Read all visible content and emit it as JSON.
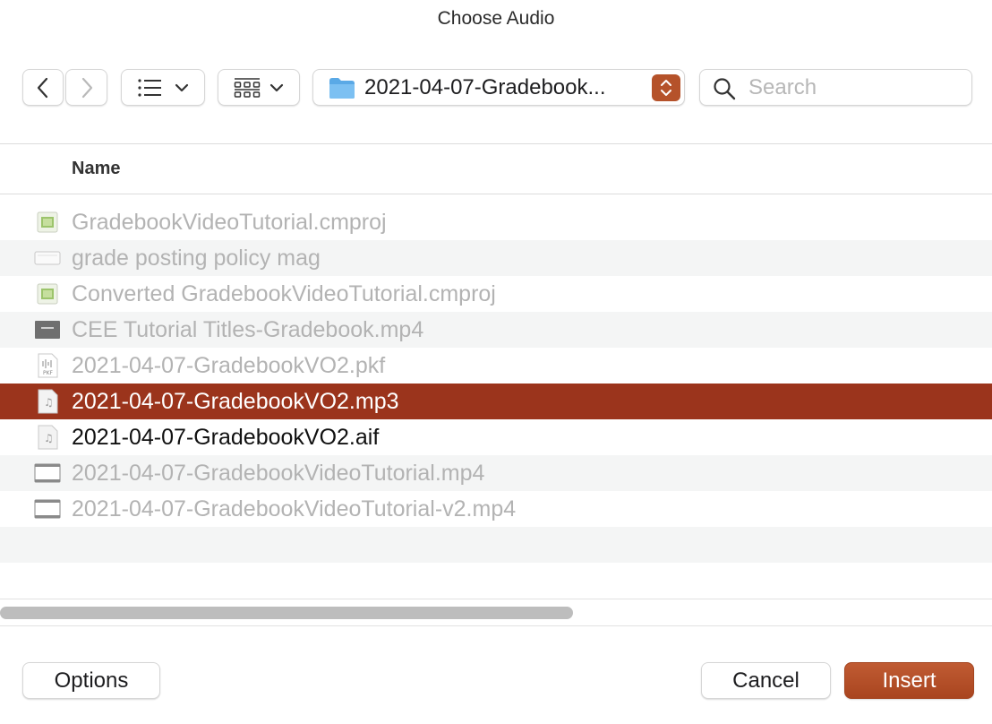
{
  "dialog": {
    "title": "Choose Audio"
  },
  "toolbar": {
    "back": "back",
    "forward": "forward",
    "list_view": "list-view",
    "icon_view": "icon-view",
    "location": "2021-04-07-Gradebook...",
    "search_placeholder": "Search"
  },
  "list": {
    "column_header": "Name",
    "rows": [
      {
        "name": "GradebookVideoTutorial.cmproj",
        "icon": "cmproj-icon",
        "state": "disabled"
      },
      {
        "name": "grade posting policy mag",
        "icon": "document-icon",
        "state": "disabled"
      },
      {
        "name": "Converted GradebookVideoTutorial.cmproj",
        "icon": "cmproj-icon",
        "state": "disabled"
      },
      {
        "name": "CEE Tutorial Titles-Gradebook.mp4",
        "icon": "video-thumb-icon",
        "state": "disabled"
      },
      {
        "name": "2021-04-07-GradebookVO2.pkf",
        "icon": "pkf-icon",
        "state": "disabled"
      },
      {
        "name": "2021-04-07-GradebookVO2.mp3",
        "icon": "audio-file-icon",
        "state": "selected"
      },
      {
        "name": "2021-04-07-GradebookVO2.aif",
        "icon": "audio-file-icon",
        "state": "enabled"
      },
      {
        "name": "2021-04-07-GradebookVideoTutorial.mp4",
        "icon": "video-file-icon",
        "state": "disabled"
      },
      {
        "name": "2021-04-07-GradebookVideoTutorial-v2.mp4",
        "icon": "video-file-icon",
        "state": "disabled"
      }
    ]
  },
  "footer": {
    "options_label": "Options",
    "cancel_label": "Cancel",
    "insert_label": "Insert"
  },
  "colors": {
    "accent": "#b5522a",
    "selection": "#9b341c",
    "insert_button": "#b24d26"
  }
}
